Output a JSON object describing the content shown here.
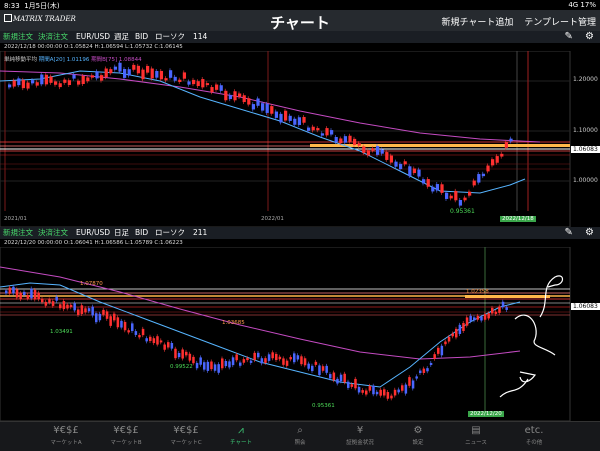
{
  "status_bar": {
    "time": "8:33",
    "date": "1月5日(木)",
    "right": "4G 17%"
  },
  "app_bar": {
    "logo": "MATRIX TRADER",
    "title": "チャート",
    "actions": [
      "新規チャート追加",
      "テンプレート管理"
    ]
  },
  "top_chart": {
    "toolbar": {
      "new_order": "新規注文",
      "close_order": "決済注文",
      "pair": "EUR/USD",
      "period": "週足",
      "side": "BID",
      "style": "ローソク",
      "count": "114"
    },
    "ohlc": "2022/12/18 00:00:00   O:1.05824  H:1.06594  L:1.05732  C:1.06145",
    "ma_legend": {
      "title": "単純移動平均",
      "a": "期間A[20]",
      "a_value": "1.01196",
      "b": "期間B[75]",
      "b_value": "1.08844"
    },
    "price_labels": [
      "1.20000",
      "1.10000",
      "1.06083",
      "1.00000"
    ],
    "low_label": "0.95361",
    "x_labels": [
      "2021/01",
      "2022/01"
    ],
    "cursor_date": "2022/12/18",
    "colors": {
      "ma_a": "#56b4ff",
      "ma_b": "#c44bc2",
      "fib": "#ffb84a"
    }
  },
  "bottom_chart": {
    "toolbar": {
      "new_order": "新規注文",
      "close_order": "決済注文",
      "pair": "EUR/USD",
      "period": "日足",
      "side": "BID",
      "style": "ローソク",
      "count": "211"
    },
    "ohlc": "2022/12/20 00:00:00   O:1.06041  H:1.06586  L:1.05789  C:1.06223",
    "price_labels": [
      "1.06083"
    ],
    "high_labels": [
      "1.07870",
      "1.03685",
      "1.02358"
    ],
    "low_labels": [
      "1.03491",
      "0.99522",
      "0.95361"
    ],
    "cursor_date": "2022/12/20"
  },
  "bottom_nav": [
    {
      "icon": "¥€$£",
      "label": "マーケットA"
    },
    {
      "icon": "¥€$£",
      "label": "マーケットB"
    },
    {
      "icon": "¥€$£",
      "label": "マーケットC"
    },
    {
      "icon": "chart-icon",
      "label": "チャート",
      "active": true
    },
    {
      "icon": "search-icon",
      "label": "照会"
    },
    {
      "icon": "deposit-icon",
      "label": "証拠金状況"
    },
    {
      "icon": "gear-icon",
      "label": "設定"
    },
    {
      "icon": "news-icon",
      "label": "ニュース"
    },
    {
      "icon": "etc.",
      "label": "その他"
    }
  ]
}
